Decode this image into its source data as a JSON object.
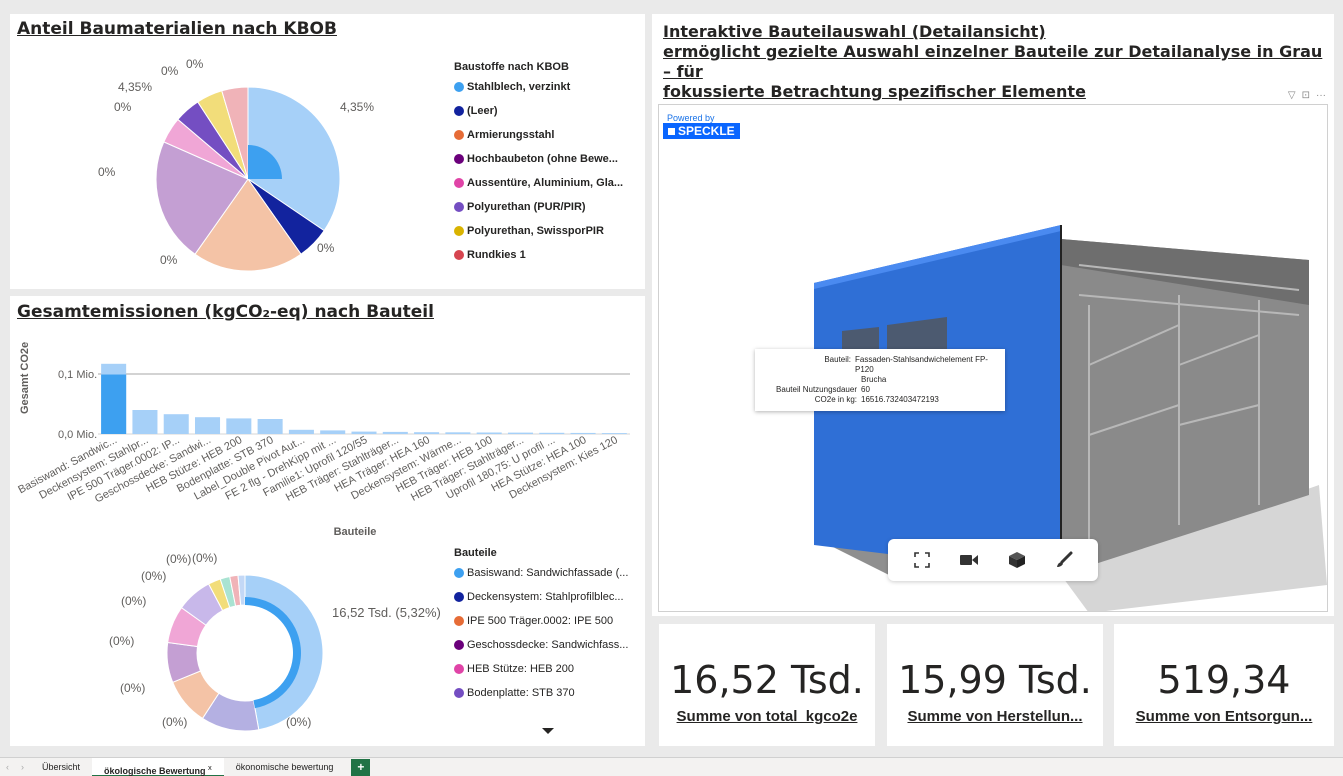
{
  "pie_panel": {
    "title": "Anteil Baumaterialien nach KBOB",
    "legend_title": "Baustoffe nach KBOB",
    "legend": [
      {
        "label": "Stahlblech, verzinkt",
        "color": "#3da0f0"
      },
      {
        "label": "(Leer)",
        "color": "#12239e"
      },
      {
        "label": "Armierungsstahl",
        "color": "#e66c37"
      },
      {
        "label": "Hochbaubeton (ohne Bewe...",
        "color": "#6b007b"
      },
      {
        "label": "Aussentüre, Aluminium, Gla...",
        "color": "#e044a7"
      },
      {
        "label": "Polyurethan (PUR/PIR)",
        "color": "#744ec2"
      },
      {
        "label": "Polyurethan, SwissporPIR",
        "color": "#d9b300"
      },
      {
        "label": "Rundkies 1",
        "color": "#d64550"
      }
    ],
    "labels": [
      "0%",
      "0%",
      "4,35%",
      "0%",
      "4,35%",
      "0%",
      "0%",
      "0%"
    ]
  },
  "bar_panel": {
    "title": "Gesamtemissionen (kgCO₂-eq) nach Bauteil",
    "ylabel": "Gesamt CO2e",
    "xlabel": "Bauteile",
    "yticks": [
      "0,1 Mio.",
      "0,0 Mio."
    ]
  },
  "donut_panel": {
    "legend_title": "Bauteile",
    "legend": [
      {
        "label": "Basiswand: Sandwichfassade (...",
        "color": "#3da0f0"
      },
      {
        "label": "Deckensystem: Stahlprofilblec...",
        "color": "#12239e"
      },
      {
        "label": "IPE 500 Träger.0002: IPE 500",
        "color": "#e66c37"
      },
      {
        "label": "Geschossdecke: Sandwichfass...",
        "color": "#6b007b"
      },
      {
        "label": "HEB Stütze: HEB 200",
        "color": "#e044a7"
      },
      {
        "label": "Bodenplatte: STB 370",
        "color": "#744ec2"
      }
    ],
    "big_label": "16,52 Tsd. (5,32%)",
    "small_labels": [
      "(0%)",
      "(0%)",
      "(0%)",
      "(0%)",
      "(0%)",
      "(0%)",
      "(0%)",
      "(0%)"
    ]
  },
  "viewer_panel": {
    "title_line1": "Interaktive Bauteilauswahl (Detailansicht)",
    "title_line2": "ermöglicht gezielte Auswahl einzelner Bauteile zur Detailanalyse in Grau – für",
    "title_line3": "fokussierte Betrachtung spezifischer Elemente",
    "powered_by": "Powered by",
    "brand": "SPECKLE",
    "tooltip": {
      "k1": "Bauteil:",
      "v1": "Fassaden-Stahlsandwichelement FP-P120",
      "v1b": "Brucha",
      "k2": "Bauteil Nutzungsdauer",
      "v2": "60",
      "k3": "CO2e in kg:",
      "v3": "16516.732403472193"
    },
    "toolbar_icons": [
      "expand-icon",
      "camera-icon",
      "cube-icon",
      "brush-icon"
    ]
  },
  "cards": [
    {
      "value": "16,52 Tsd.",
      "label": "Summe von total_kgco2e"
    },
    {
      "value": "15,99 Tsd.",
      "label": "Summe von Herstellun..."
    },
    {
      "value": "519,34",
      "label": "Summe von Entsorgun..."
    }
  ],
  "tabs": {
    "items": [
      "Übersicht",
      "ökologische Bewertung",
      "ökonomische bewertung"
    ],
    "active_index": 1,
    "close_mark": "x",
    "add_label": "+"
  },
  "chart_data": [
    {
      "type": "pie",
      "title": "Anteil Baumaterialien nach KBOB",
      "categories": [
        "Stahlblech, verzinkt",
        "(Leer)",
        "Armierungsstahl",
        "Hochbaubeton (ohne Bewe...",
        "Aussentüre, Aluminium, Gla...",
        "Polyurethan (PUR/PIR)",
        "Polyurethan, SwissporPIR",
        "Rundkies 1"
      ],
      "values": [
        30,
        5,
        17,
        19,
        4,
        4,
        4,
        4
      ]
    },
    {
      "type": "bar",
      "title": "Gesamtemissionen (kgCO₂-eq) nach Bauteil",
      "xlabel": "Bauteile",
      "ylabel": "Gesamt CO2e",
      "categories": [
        "Basiswand: Sandwic...",
        "Deckensystem: Stahlpr...",
        "IPE 500 Träger.0002: IP...",
        "Geschossdecke: Sandwi...",
        "HEB Stütze: HEB 200",
        "Bodenplatte: STB 370",
        "Label_Double Pivot Aut...",
        "FE 2 flg - DrehKipp mit ...",
        "Familie1: Uprofil 120/55",
        "HEB Träger: Stahlträger...",
        "HEA Träger: HEA 160",
        "Deckensystem: Wärme...",
        "HEB Träger: HEB 100",
        "HEB Träger: Stahlträger...",
        "Uprofil 180,75: U profil ...",
        "HEA Stütze: HEA 100",
        "Deckensystem: Kies 120"
      ],
      "series": [
        {
          "values": [
            117000,
            40000,
            33000,
            28000,
            26000,
            25000,
            7000,
            6000,
            4000,
            3500,
            3000,
            2800,
            2500,
            2300,
            2000,
            1800,
            1500
          ]
        }
      ],
      "highlight": {
        "index": 0,
        "value": 16520
      },
      "ylim": [
        0,
        130000
      ]
    },
    {
      "type": "pie",
      "title": "",
      "categories": [
        "Basiswand: Sandwichfassade (...",
        "Deckensystem: Stahlprofilblec...",
        "IPE 500 Träger.0002: IPE 500",
        "Geschossdecke: Sandwichfass...",
        "HEB Stütze: HEB 200",
        "Bodenplatte: STB 370"
      ],
      "values": [
        16520,
        4200,
        3400,
        2900,
        2700,
        2600
      ]
    }
  ]
}
